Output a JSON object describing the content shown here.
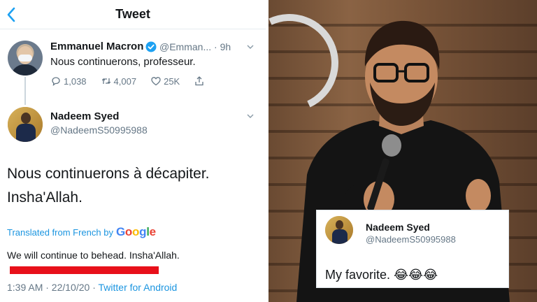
{
  "header": {
    "title": "Tweet",
    "back_icon": "chevron-left-icon",
    "accent": "#1da1f2"
  },
  "parent_tweet": {
    "name": "Emmanuel Macron",
    "handle": "@Emman...",
    "time": "· 9h",
    "text": "Nous continuerons, professeur.",
    "reply_count": "1,038",
    "retweet_count": "4,007",
    "like_count": "25K"
  },
  "reply_tweet": {
    "name": "Nadeem Syed",
    "handle": "@NadeemS50995988",
    "text_line1": "Nous continuerons à décapiter.",
    "text_line2": "Insha'Allah.",
    "translated_prefix": "Translated from French by",
    "translation": "We will continue to behead. Insha'Allah.",
    "timestamp": "1:39 AM · 22/10/20 ·",
    "source": "Twitter for Android",
    "redaction_color": "#e8101a"
  },
  "logo": {
    "text": "Google"
  },
  "overlay_card": {
    "name": "Nadeem Syed",
    "handle": "@NadeemS50995988",
    "text": "My favorite. 😂😂😂"
  },
  "colors": {
    "link": "#1b95e0",
    "muted": "#657786",
    "verified": "#1da1f2"
  }
}
